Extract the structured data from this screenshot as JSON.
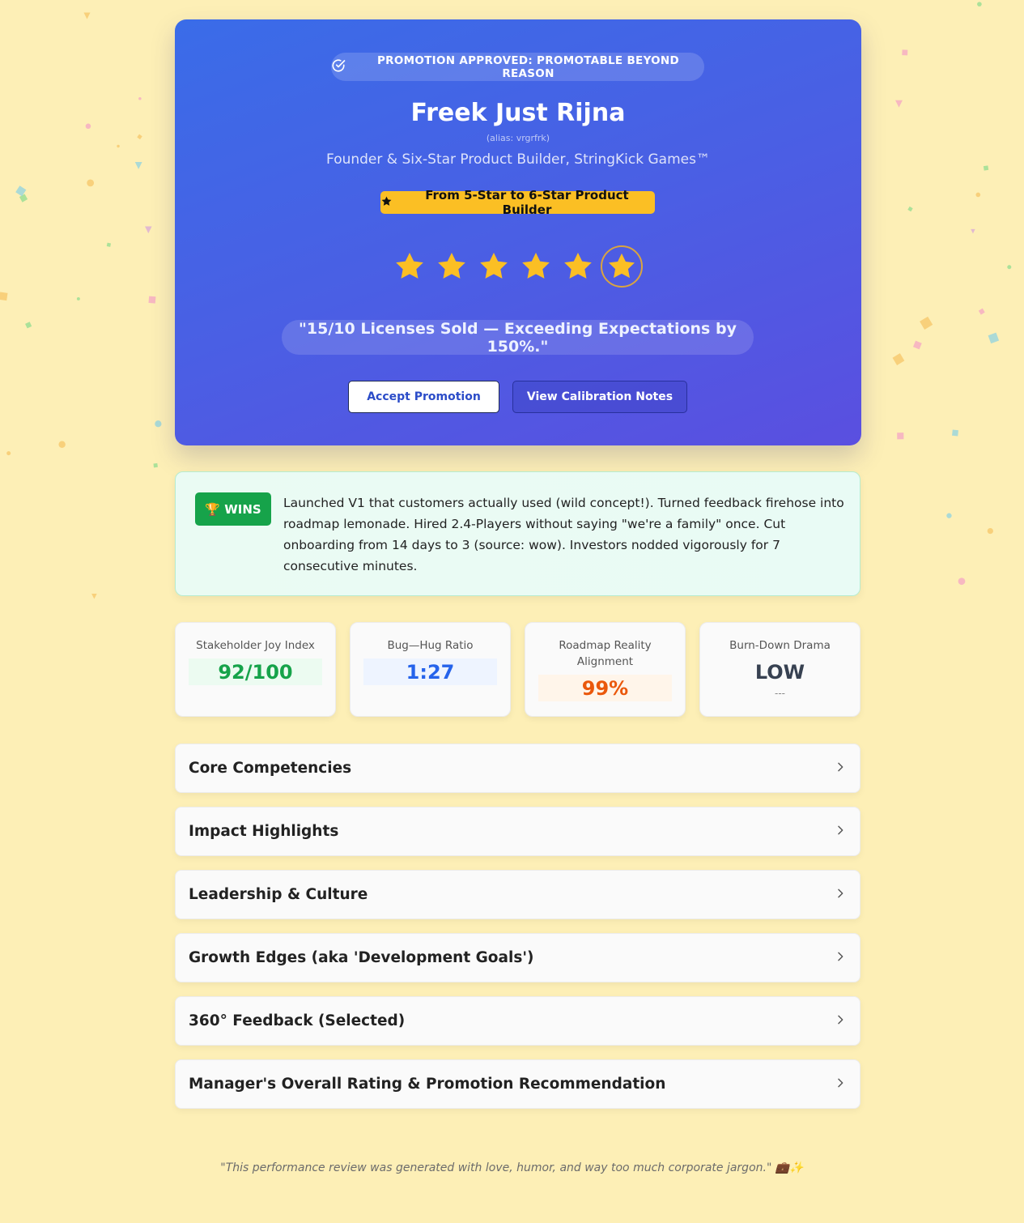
{
  "hero": {
    "approval_label": "PROMOTION APPROVED: PROMOTABLE BEYOND REASON",
    "name": "Freek Just Rijna",
    "alias": "(alias: vrgrfrk)",
    "role": "Founder & Six-Star Product Builder, StringKick Games™",
    "upgrade_label": "From 5-Star to 6-Star Product Builder",
    "rating": {
      "filled": 6,
      "max": 6
    },
    "quote": "\"15/10 Licenses Sold — Exceeding Expectations by 150%.\"",
    "accept_label": "Accept Promotion",
    "notes_label": "View Calibration Notes"
  },
  "wins": {
    "badge": "🏆 WINS",
    "text": "Launched V1 that customers actually used (wild concept!). Turned feedback firehose into roadmap lemonade. Hired 2.4-Players without saying \"we're a family\" once. Cut onboarding from 14 days to 3 (source: wow). Investors nodded vigorously for 7 consecutive minutes."
  },
  "metrics": [
    {
      "label": "Stakeholder Joy Index",
      "value": "92/100",
      "color": "#16a34a",
      "bg": "#ecfbf1"
    },
    {
      "label": "Bug—Hug Ratio",
      "value": "1:27",
      "color": "#2563eb",
      "bg": "#eef4ff"
    },
    {
      "label": "Roadmap Reality Alignment",
      "value": "99%",
      "color": "#ea580c",
      "bg": "#fff5ea"
    },
    {
      "label": "Burn-Down Drama",
      "value": "LOW",
      "sub": "---",
      "color": "#374151",
      "bg": "transparent"
    }
  ],
  "sections": [
    "Core Competencies",
    "Impact Highlights",
    "Leadership & Culture",
    "Growth Edges (aka 'Development Goals')",
    "360° Feedback (Selected)",
    "Manager's Overall Rating & Promotion Recommendation"
  ],
  "footer": "\"This performance review was generated with love, humor, and way too much corporate jargon.\" 💼✨",
  "colors": {
    "background": "#fdefb6",
    "hero_start": "#3a6ce8",
    "hero_end": "#5a4fe0",
    "star": "#fbbf24",
    "wins_green": "#16a34a"
  },
  "icons": {
    "approval": "check-circle-icon",
    "upgrade": "star-icon",
    "accordion": "chevron-right-icon"
  }
}
